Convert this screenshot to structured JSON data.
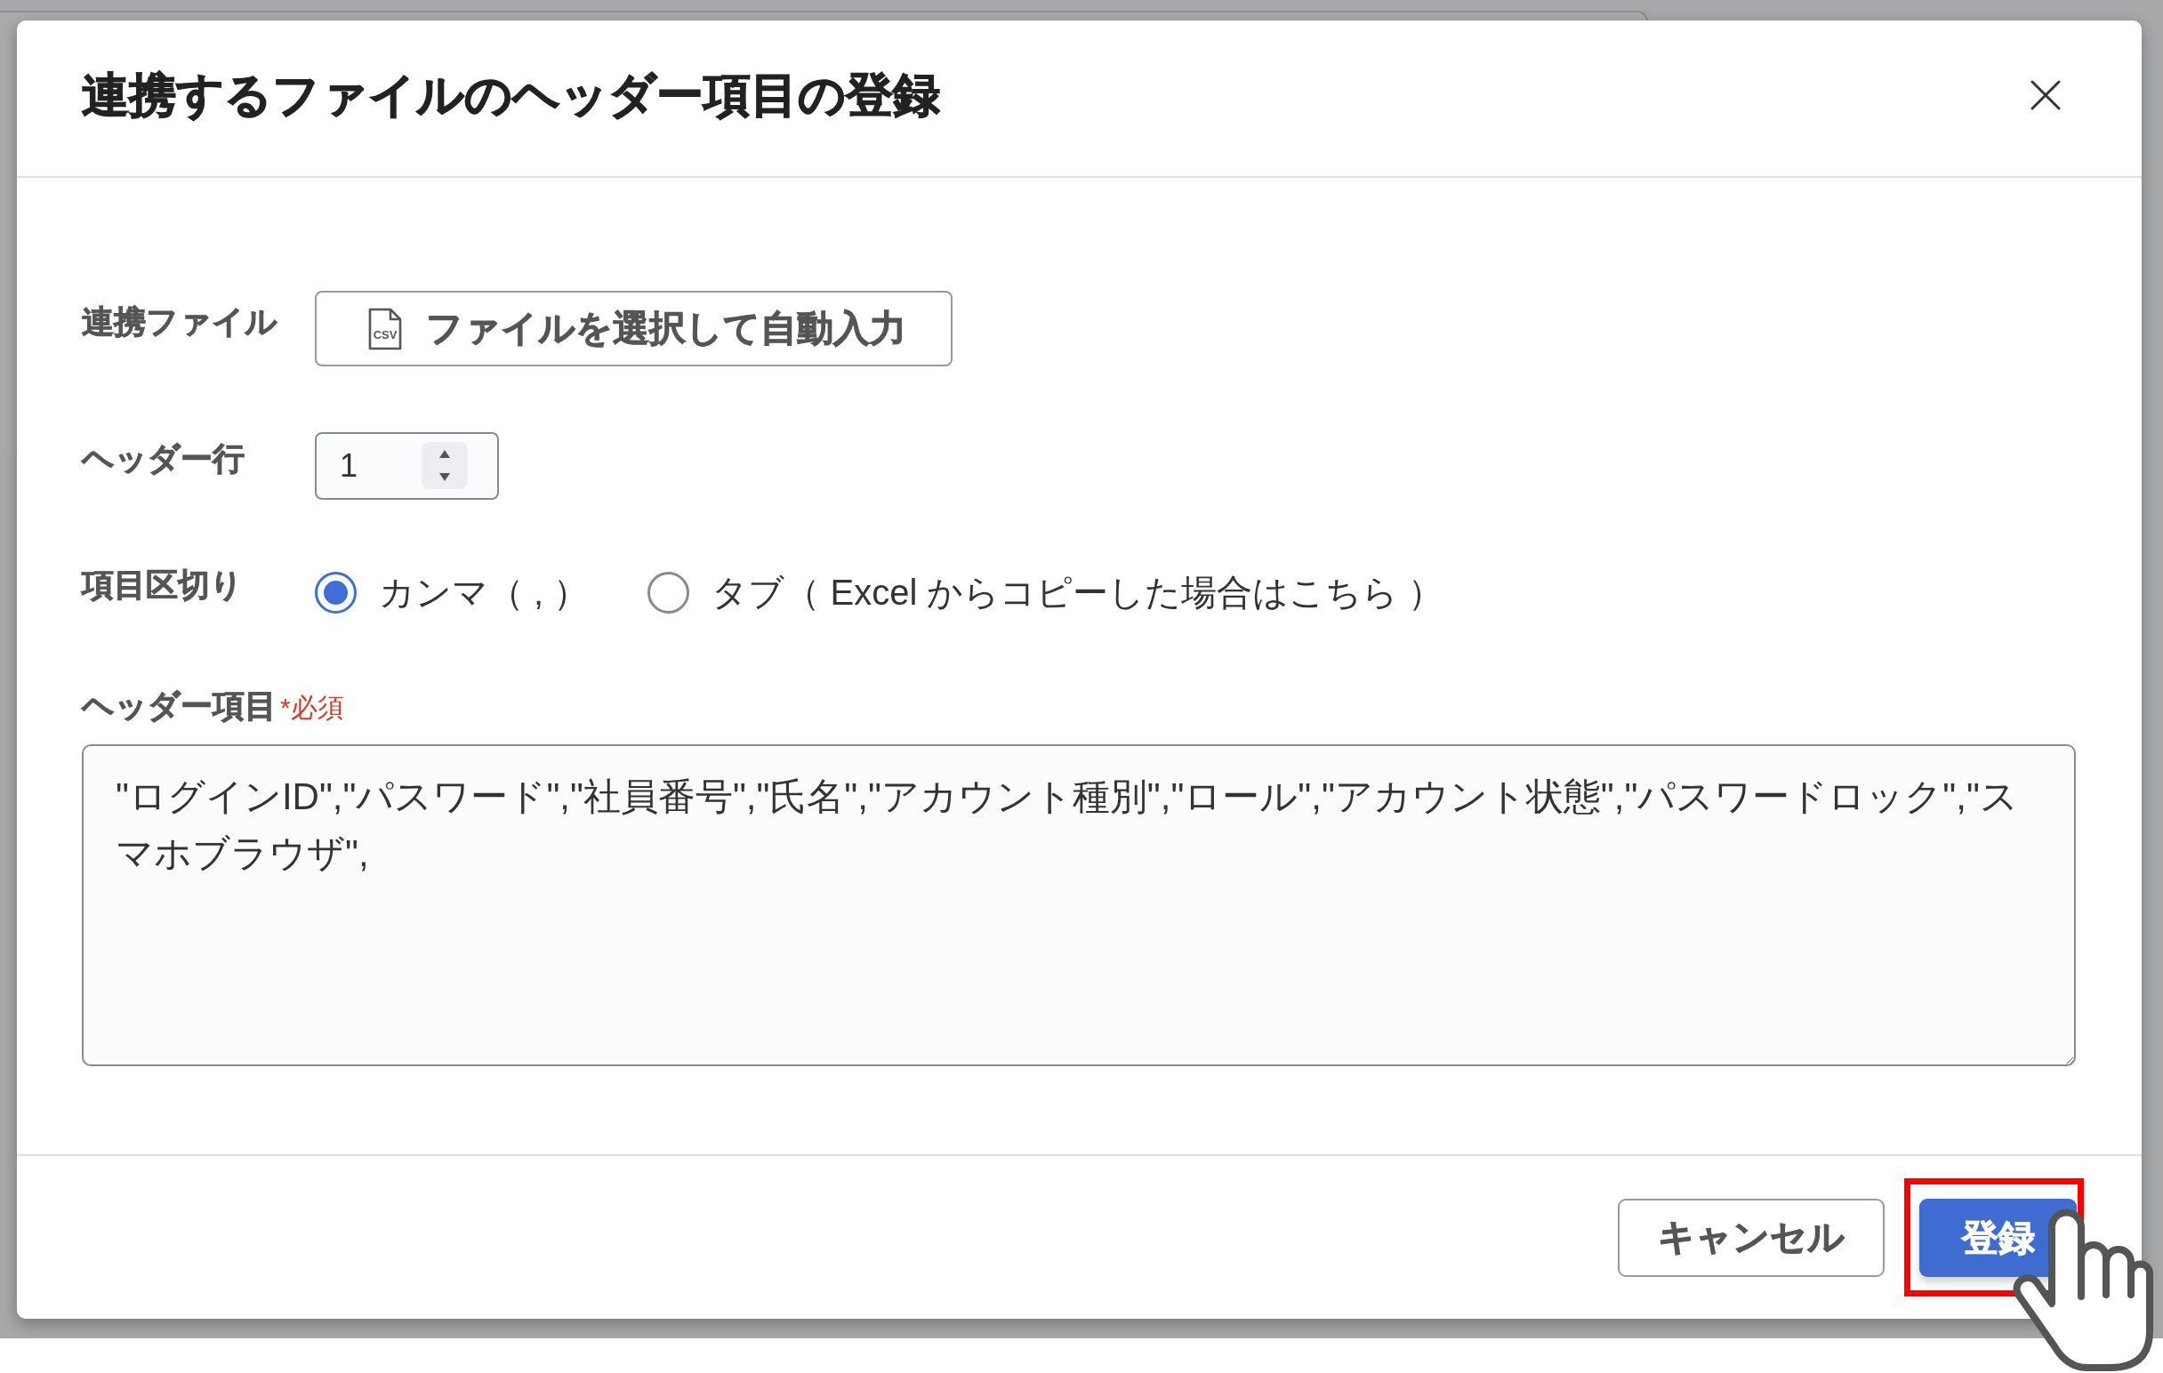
{
  "dialog": {
    "title": "連携するファイルのヘッダー項目の登録",
    "form": {
      "file": {
        "label": "連携ファイル",
        "button": {
          "label": "ファイルを選択して自動入力",
          "icon_text": "CSV"
        }
      },
      "header_row": {
        "label": "ヘッダー行",
        "value": "1"
      },
      "delimiter": {
        "label": "項目区切り",
        "options": [
          {
            "label": "カンマ（ , ）",
            "selected": true
          },
          {
            "label": "タブ（ Excel からコピーした場合はこちら ）",
            "selected": false
          }
        ]
      },
      "header_items": {
        "label": "ヘッダー項目",
        "required": "*必須",
        "value": "\"ログインID\",\"パスワード\",\"社員番号\",\"氏名\",\"アカウント種別\",\"ロール\",\"アカウント状態\",\"パスワードロック\",\"スマホブラウザ\","
      }
    },
    "footer": {
      "buttons": [
        {
          "label": "キャンセル",
          "kind": "cancel",
          "highlighted": false
        },
        {
          "label": "登録",
          "kind": "submit",
          "highlighted": true
        }
      ]
    }
  }
}
